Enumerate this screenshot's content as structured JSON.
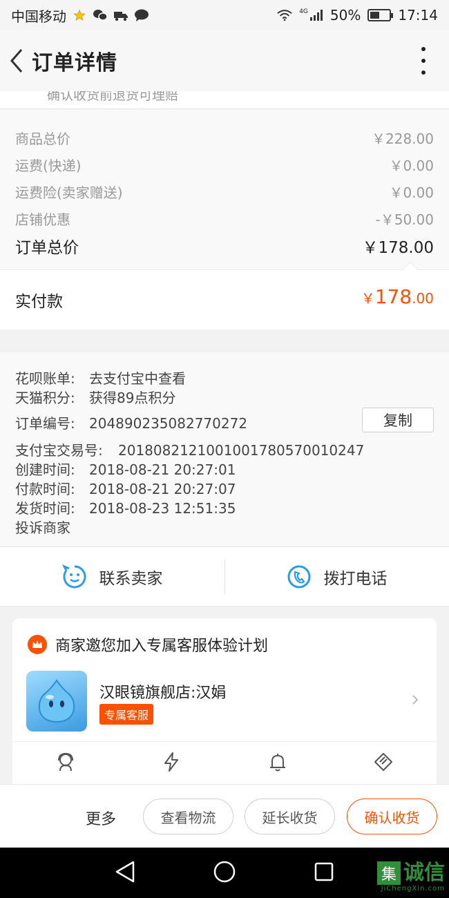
{
  "status_bar": {
    "carrier": "中国移动",
    "network": "4G",
    "battery_text": "50%",
    "battery_level": 0.5,
    "time": "17:14"
  },
  "nav": {
    "title": "订单详情"
  },
  "clipped_note": "确认收货前退货可理赔",
  "prices": {
    "items": [
      {
        "label": "商品总价",
        "value": "￥228.00"
      },
      {
        "label": "运费(快递)",
        "value": "￥0.00"
      },
      {
        "label": "运费险(卖家赠送)",
        "value": "￥0.00"
      },
      {
        "label": "店铺优惠",
        "value": "-￥50.00"
      }
    ],
    "total_label": "订单总价",
    "total_value": "￥178.00",
    "paid_label": "实付款",
    "paid_currency": "￥",
    "paid_integer": "178",
    "paid_decimal": ".00"
  },
  "info": {
    "huabei_key": "花呗账单:",
    "huabei_val": "去支付宝中查看",
    "points_key": "天猫积分:",
    "points_val": "获得89点积分",
    "order_no_key": "订单编号:",
    "order_no_val": "204890235082770272",
    "copy_label": "复制",
    "alipay_key": "支付宝交易号:",
    "alipay_val": "2018082121001001780570010247",
    "created_key": "创建时间:",
    "created_val": "2018-08-21 20:27:01",
    "paid_key": "付款时间:",
    "paid_val": "2018-08-21 20:27:07",
    "shipped_key": "发货时间:",
    "shipped_val": "2018-08-23 12:51:35",
    "complaint": "投诉商家"
  },
  "contact": {
    "seller_label": "联系卖家",
    "phone_label": "拨打电话"
  },
  "service": {
    "header": "商家邀您加入专属客服体验计划",
    "store_name": "汉眼镜旗舰店:汉娟",
    "badge": "专属客服"
  },
  "actions": {
    "more": "更多",
    "logistics": "查看物流",
    "extend": "延长收货",
    "confirm": "确认收货"
  },
  "watermark": {
    "box_char": "集",
    "text": "诚信",
    "sub": "JiChengXin.com"
  },
  "colors": {
    "accent": "#ff5000",
    "icon_blue": "#2a9be6"
  }
}
